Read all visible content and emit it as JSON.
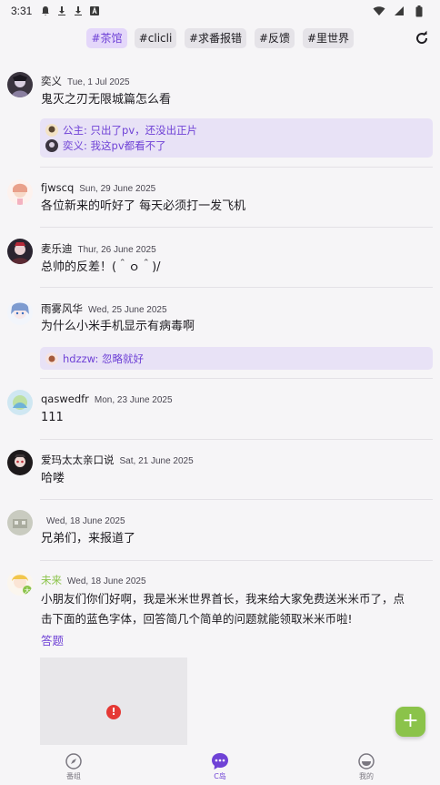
{
  "status_bar": {
    "time": "3:31",
    "icons": [
      "notification-icon",
      "download-icon",
      "download-icon",
      "a-icon"
    ],
    "right_icons": [
      "wifi-icon",
      "signal-icon",
      "battery-icon"
    ]
  },
  "tags": [
    {
      "label": "#茶馆",
      "active": true
    },
    {
      "label": "#clicli",
      "active": false
    },
    {
      "label": "#求番报错",
      "active": false
    },
    {
      "label": "#反馈",
      "active": false
    },
    {
      "label": "#里世界",
      "active": false
    }
  ],
  "posts": [
    {
      "user": "奕义",
      "date": "Tue, 1 Jul 2025",
      "content": "鬼灭之刃无限城篇怎么看",
      "replies": [
        {
          "text": "公主: 只出了pv，还没出正片"
        },
        {
          "text": "奕义: 我这pv都看不了"
        }
      ]
    },
    {
      "user": "fjwscq",
      "date": "Sun, 29 June 2025",
      "content": "各位新来的听好了 每天必须打一发飞机"
    },
    {
      "user": "麦乐迪",
      "date": "Thur, 26 June 2025",
      "content": "总帅的反差！(＾ｏ＾)/"
    },
    {
      "user": "雨雾风华",
      "date": "Wed, 25 June 2025",
      "content": "为什么小米手机显示有病毒啊",
      "replies": [
        {
          "text": "hdzzw: 忽略就好"
        }
      ]
    },
    {
      "user": "qaswedfr",
      "date": "Mon, 23 June 2025",
      "content": "111"
    },
    {
      "user": "爱玛太太亲口说",
      "date": "Sat, 21 June 2025",
      "content": "哈喽"
    },
    {
      "user": "",
      "date": "Wed, 18 June 2025",
      "content": "兄弟们，来报道了"
    },
    {
      "user": "未来",
      "date": "Wed, 18 June 2025",
      "content_line1": "小朋友们你们好啊，我是米米世界首长，我来给大家免费送米米币了，点",
      "content_line2": "击下面的蓝色字体，回答简几个简单的问题就能领取米米币啦!",
      "link": "答题",
      "image_status": "!"
    }
  ],
  "fab": {
    "label": "+"
  },
  "bottom_nav": [
    {
      "label": "番组",
      "icon": "compass-icon"
    },
    {
      "label": "C岛",
      "icon": "chat-icon",
      "active": true
    },
    {
      "label": "我的",
      "icon": "profile-icon"
    }
  ],
  "colors": {
    "accent": "#6f42d6",
    "accent_light": "#e8e2f6",
    "fab": "#8bc34a",
    "error": "#e53935",
    "special_username": "#8bc34a"
  }
}
